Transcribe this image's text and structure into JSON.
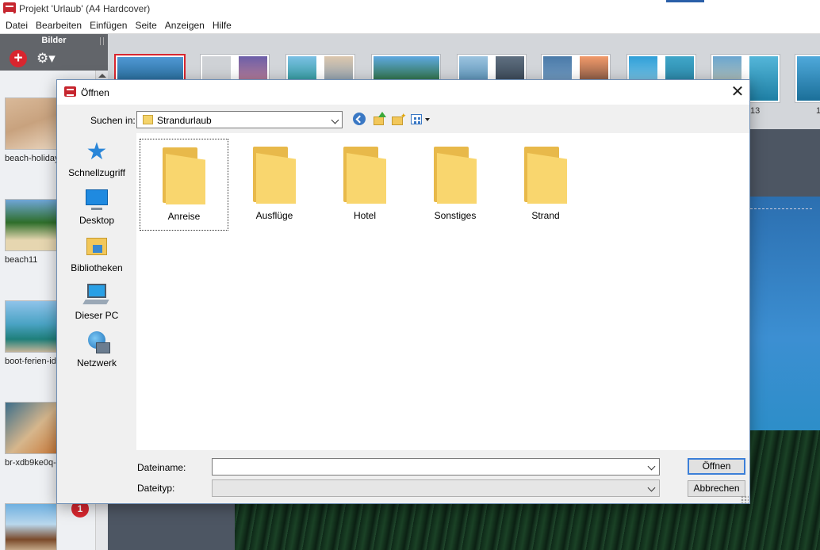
{
  "app": {
    "title": "Projekt 'Urlaub' (A4 Hardcover)"
  },
  "menu": [
    "Datei",
    "Bearbeiten",
    "Einfügen",
    "Seite",
    "Anzeigen",
    "Hilfe"
  ],
  "bilder_panel": {
    "title": "Bilder",
    "items": [
      {
        "name": "beach-holiday"
      },
      {
        "name": "beach11"
      },
      {
        "name": "boot-ferien-id"
      },
      {
        "name": "br-xdb9ke0q-"
      }
    ],
    "badge": "1"
  },
  "page_strip": {
    "labels": [
      "13",
      "1"
    ]
  },
  "dialog": {
    "title": "Öffnen",
    "look_in_label": "Suchen in:",
    "look_in_value": "Strandurlaub",
    "places": [
      "Schnellzugriff",
      "Desktop",
      "Bibliotheken",
      "Dieser PC",
      "Netzwerk"
    ],
    "folders": [
      "Anreise",
      "Ausflüge",
      "Hotel",
      "Sonstiges",
      "Strand"
    ],
    "filename_label": "Dateiname:",
    "filename_value": "",
    "filetype_label": "Dateityp:",
    "filetype_value": "",
    "open_button": "Öffnen",
    "cancel_button": "Abbrechen"
  },
  "colors": {
    "accent_red": "#d8262f",
    "accent_blue": "#3c7fd8",
    "folder_yellow": "#f9d66e"
  }
}
